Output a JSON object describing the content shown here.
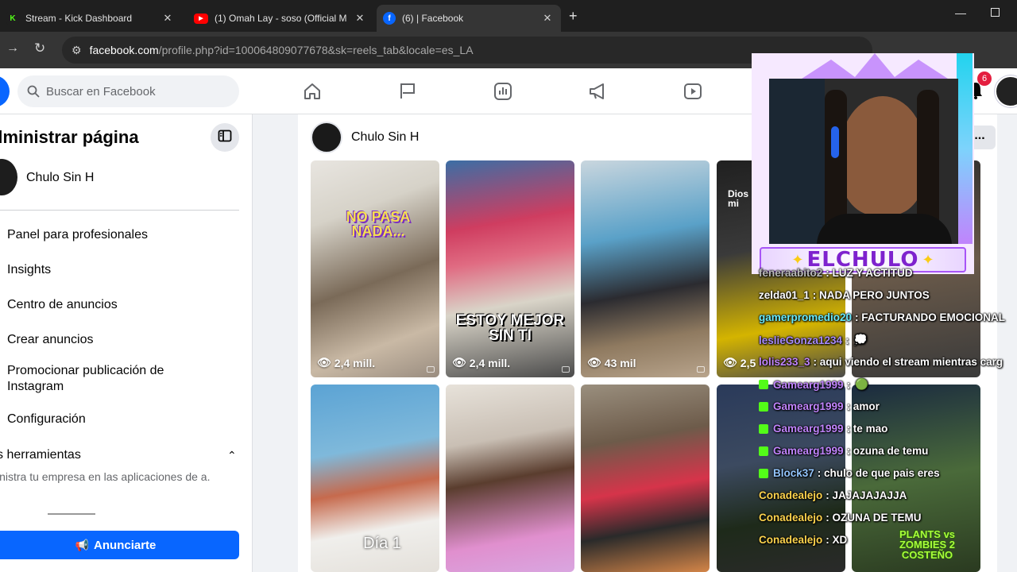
{
  "browser": {
    "tabs": [
      {
        "title": "Stream - Kick Dashboard",
        "icon": "kick-icon",
        "color": "#53fc18"
      },
      {
        "title": "(1) Omah Lay - soso (Official M",
        "icon": "youtube-icon",
        "color": "#ff0000"
      },
      {
        "title": "(6) | Facebook",
        "icon": "facebook-icon",
        "color": "#0866ff"
      }
    ],
    "new_tab": "+",
    "url_host": "facebook.com",
    "url_rest": "/profile.php?id=100064809077678&sk=reels_tab&locale=es_LA"
  },
  "fb": {
    "search_placeholder": "Buscar en Facebook",
    "notification_count": "6",
    "accent": "#0866ff"
  },
  "left_panel": {
    "title": "dministrar página",
    "page_name": "Chulo Sin H",
    "items": [
      "Panel para profesionales",
      "Insights",
      "Centro de anuncios",
      "Crear anuncios",
      "Promocionar publicación de Instagram",
      "Configuración"
    ],
    "tools_title": "s herramientas",
    "tools_desc": "inistra tu empresa en las aplicaciones de a.",
    "advertise_label": "Anunciarte"
  },
  "profile": {
    "name": "Chulo Sin H",
    "more": "..."
  },
  "reels": [
    {
      "views": "2,4 mill.",
      "caption": "NO PASA NADA..."
    },
    {
      "views": "2,4 mill.",
      "caption": "ESTOY MEJOR SIN TI"
    },
    {
      "views": "43 mil",
      "caption": ""
    },
    {
      "views": "2,5",
      "caption": "Dios mi"
    },
    {
      "views": "",
      "caption": ""
    },
    {
      "views": "",
      "caption": "Día 1"
    },
    {
      "views": "",
      "caption": ""
    },
    {
      "views": "",
      "caption": ""
    },
    {
      "views": "",
      "caption": "PLANTS vs ZOMBIES 2 COSTEÑO"
    },
    {
      "views": "",
      "caption": ""
    }
  ],
  "stream": {
    "streamer_name": "ELCHULO",
    "chat": [
      {
        "user": "feneraabito2",
        "text": ": LUZ Y ACTITUD",
        "color": "#b9b9b9",
        "badge": false
      },
      {
        "user": "zelda01_1",
        "text": ": NADA PERO JUNTOS",
        "color": "#ffffff",
        "badge": false
      },
      {
        "user": "gamerpromedio20",
        "text": ": FACTURANDO EMOCIONAL",
        "color": "#67e8f9",
        "badge": false
      },
      {
        "user": "leslieGonza1234",
        "text": ":",
        "color": "#a78bfa",
        "badge": false
      },
      {
        "user": "lolis233_3",
        "text": ": aqui viendo el stream mientras carg",
        "color": "#c084fc",
        "badge": false
      },
      {
        "user": "Gamearg1999",
        "text": ":",
        "color": "#c084fc",
        "badge": true
      },
      {
        "user": "Gamearg1999",
        "text": ": amor",
        "color": "#c084fc",
        "badge": true
      },
      {
        "user": "Gamearg1999",
        "text": ": te mao",
        "color": "#c084fc",
        "badge": true
      },
      {
        "user": "Gamearg1999",
        "text": ": ozuna de temu",
        "color": "#c084fc",
        "badge": true
      },
      {
        "user": "Block37",
        "text": ": chulo de que pais eres",
        "color": "#93c5fd",
        "badge": true
      },
      {
        "user": "Conadealejo",
        "text": ": JAJAJAJAJJA",
        "color": "#fcd34d",
        "badge": false
      },
      {
        "user": "Conadealejo",
        "text": ": OZUNA DE TEMU",
        "color": "#fcd34d",
        "badge": false
      },
      {
        "user": "Conadealejo",
        "text": ": XD",
        "color": "#fcd34d",
        "badge": false
      }
    ]
  }
}
